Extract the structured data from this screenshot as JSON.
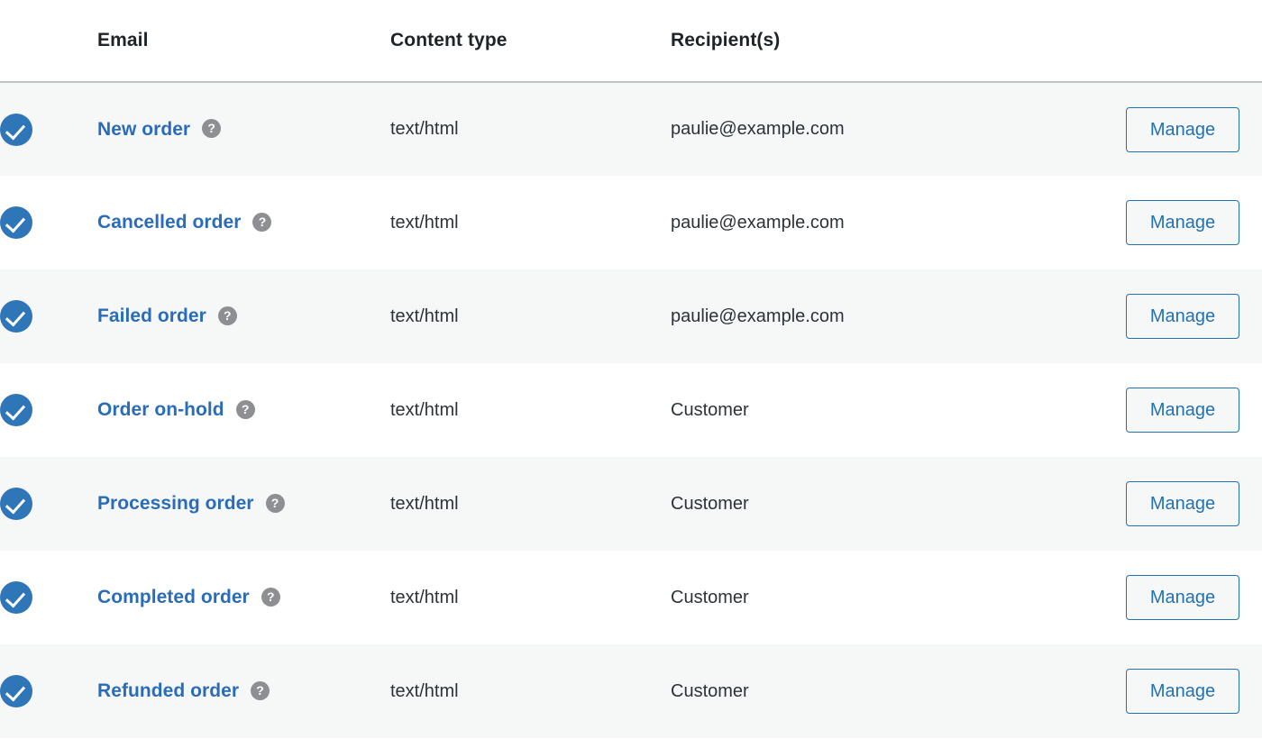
{
  "table": {
    "columns": [
      {
        "key": "status",
        "label": ""
      },
      {
        "key": "email",
        "label": "Email"
      },
      {
        "key": "type",
        "label": "Content type"
      },
      {
        "key": "recip",
        "label": "Recipient(s)"
      },
      {
        "key": "actions",
        "label": ""
      }
    ],
    "headers": {
      "email": "Email",
      "content_type": "Content type",
      "recipients": "Recipient(s)"
    },
    "help_icon_glyph": "?",
    "manage_label": "Manage",
    "rows": [
      {
        "enabled": true,
        "name": "New order",
        "content_type": "text/html",
        "recipient": "paulie@example.com",
        "action": "Manage"
      },
      {
        "enabled": true,
        "name": "Cancelled order",
        "content_type": "text/html",
        "recipient": "paulie@example.com",
        "action": "Manage"
      },
      {
        "enabled": true,
        "name": "Failed order",
        "content_type": "text/html",
        "recipient": "paulie@example.com",
        "action": "Manage"
      },
      {
        "enabled": true,
        "name": "Order on-hold",
        "content_type": "text/html",
        "recipient": "Customer",
        "action": "Manage"
      },
      {
        "enabled": true,
        "name": "Processing order",
        "content_type": "text/html",
        "recipient": "Customer",
        "action": "Manage"
      },
      {
        "enabled": true,
        "name": "Completed order",
        "content_type": "text/html",
        "recipient": "Customer",
        "action": "Manage"
      },
      {
        "enabled": true,
        "name": "Refunded order",
        "content_type": "text/html",
        "recipient": "Customer",
        "action": "Manage"
      }
    ]
  },
  "colors": {
    "link_blue": "#2b6cb8",
    "check_blue": "#2e76b8",
    "button_blue": "#2271b1",
    "header_text": "#1d2327",
    "body_text": "#2c3338",
    "row_alt_bg": "#f6f7f7",
    "row_bg": "#ffffff",
    "header_border": "#c3c4c7",
    "help_icon_bg": "#8d8f92"
  }
}
